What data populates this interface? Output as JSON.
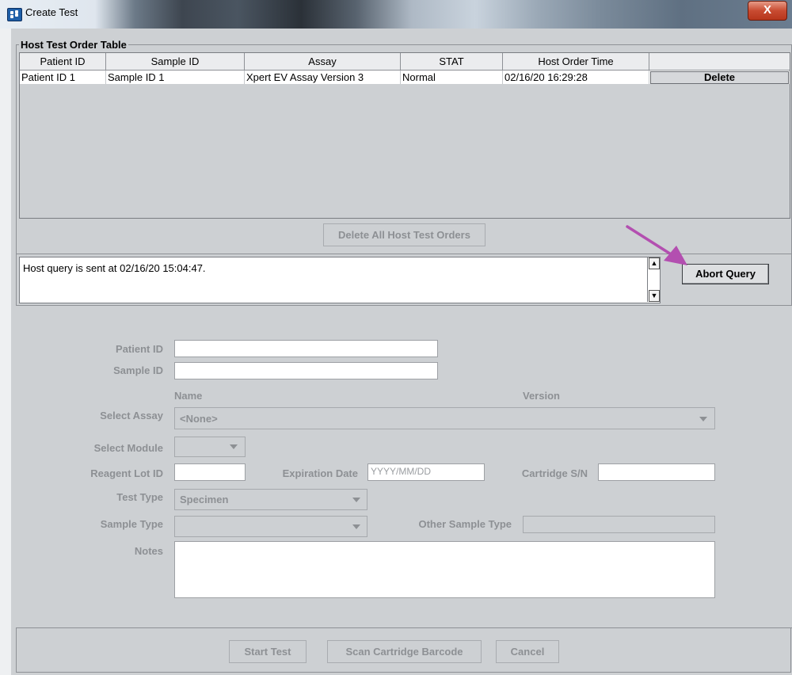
{
  "window": {
    "title": "Create Test",
    "close_glyph": "X"
  },
  "host_table": {
    "group_title": "Host Test Order Table",
    "columns": [
      "Patient ID",
      "Sample ID",
      "Assay",
      "STAT",
      "Host Order Time",
      ""
    ],
    "rows": [
      {
        "patient_id": "Patient ID 1",
        "sample_id": "Sample ID 1",
        "assay": "Xpert EV Assay Version 3",
        "stat": "Normal",
        "host_order_time": "02/16/20  16:29:28",
        "action": "Delete"
      }
    ]
  },
  "buttons": {
    "delete_all": "Delete All Host Test Orders",
    "abort_query": "Abort Query",
    "start_test": "Start Test",
    "scan_barcode": "Scan Cartridge Barcode",
    "cancel": "Cancel"
  },
  "status_message": "Host query is sent at 02/16/20 15:04:47.",
  "form": {
    "patient_id_label": "Patient ID",
    "sample_id_label": "Sample ID",
    "name_header": "Name",
    "version_header": "Version",
    "select_assay_label": "Select Assay",
    "select_assay_value": "<None>",
    "select_module_label": "Select Module",
    "reagent_lot_label": "Reagent Lot ID",
    "expiration_label": "Expiration Date",
    "expiration_placeholder": "YYYY/MM/DD",
    "cartridge_sn_label": "Cartridge S/N",
    "test_type_label": "Test Type",
    "test_type_value": "Specimen",
    "sample_type_label": "Sample Type",
    "other_sample_type_label": "Other Sample Type",
    "notes_label": "Notes"
  },
  "colors": {
    "panel_bg": "#cdd0d3",
    "annotation_arrow": "#b34fb0",
    "close_button": "#c84b31"
  }
}
